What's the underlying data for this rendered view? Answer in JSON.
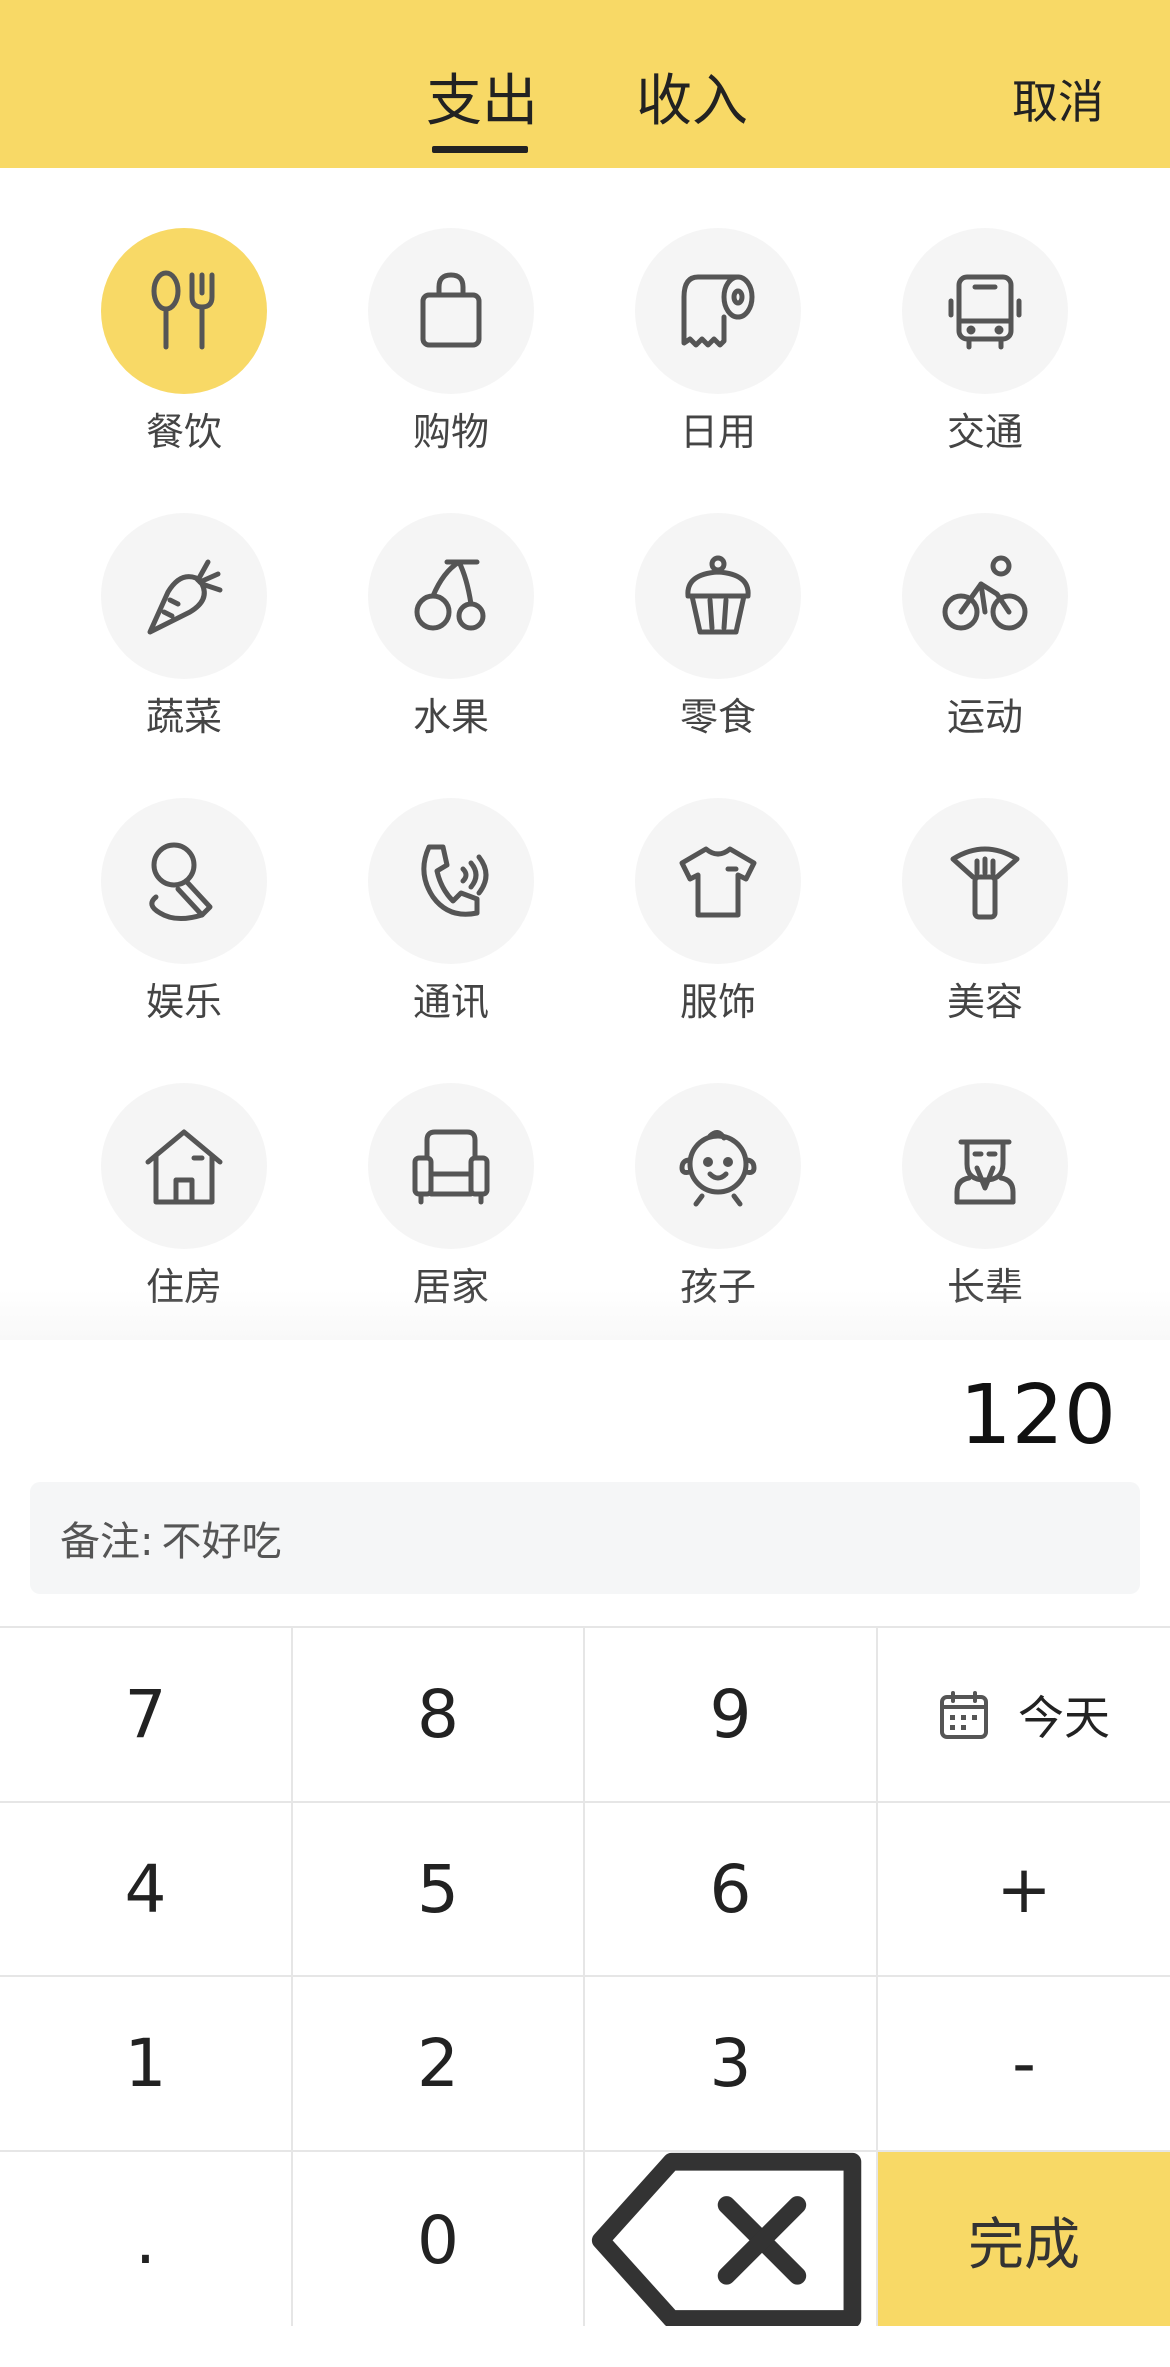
{
  "header": {
    "tab_expense": "支出",
    "tab_income": "收入",
    "active_tab": "支出",
    "cancel_label": "取消",
    "background_color": "#f8d966"
  },
  "categories": [
    {
      "label": "餐饮",
      "icon": "utensils-icon",
      "selected": true
    },
    {
      "label": "购物",
      "icon": "shopping-bag-icon",
      "selected": false
    },
    {
      "label": "日用",
      "icon": "toilet-paper-icon",
      "selected": false
    },
    {
      "label": "交通",
      "icon": "bus-icon",
      "selected": false
    },
    {
      "label": "蔬菜",
      "icon": "carrot-icon",
      "selected": false
    },
    {
      "label": "水果",
      "icon": "cherry-icon",
      "selected": false
    },
    {
      "label": "零食",
      "icon": "cupcake-icon",
      "selected": false
    },
    {
      "label": "运动",
      "icon": "cyclist-icon",
      "selected": false
    },
    {
      "label": "娱乐",
      "icon": "microphone-icon",
      "selected": false
    },
    {
      "label": "通讯",
      "icon": "phone-icon",
      "selected": false
    },
    {
      "label": "服饰",
      "icon": "tshirt-icon",
      "selected": false
    },
    {
      "label": "美容",
      "icon": "brush-icon",
      "selected": false
    },
    {
      "label": "住房",
      "icon": "house-icon",
      "selected": false
    },
    {
      "label": "居家",
      "icon": "armchair-icon",
      "selected": false
    },
    {
      "label": "孩子",
      "icon": "baby-face-icon",
      "selected": false
    },
    {
      "label": "长辈",
      "icon": "elder-icon",
      "selected": false
    }
  ],
  "amount": "120",
  "note": {
    "prefix": "备注:",
    "value": "不好吃"
  },
  "keypad": {
    "k7": "7",
    "k8": "8",
    "k9": "9",
    "today": "今天",
    "k4": "4",
    "k5": "5",
    "k6": "6",
    "plus": "+",
    "k1": "1",
    "k2": "2",
    "k3": "3",
    "minus": "-",
    "dot": ".",
    "k0": "0",
    "backspace_icon": "backspace-icon",
    "done": "完成"
  },
  "colors": {
    "accent": "#f8d966",
    "icon_stroke": "#555555",
    "circle_bg": "#f5f5f5"
  }
}
